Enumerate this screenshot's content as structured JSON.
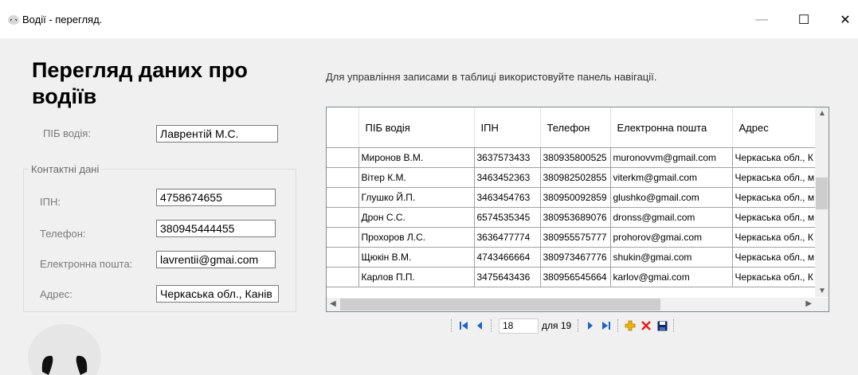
{
  "window": {
    "title": "Водії - перегляд.",
    "minimize": "—",
    "maximize": "☐",
    "close": "✕"
  },
  "heading": "Перегляд даних про водіїв",
  "form": {
    "name_label": "ПІБ водія:",
    "name_value": "Лаврентій М.С.",
    "contacts_group_title": "Контактні дані",
    "ipn_label": "ІПН:",
    "ipn_value": "4758674655",
    "phone_label": "Телефон:",
    "phone_value": "380945444455",
    "email_label": "Електронна пошта:",
    "email_value": "lavrentii@gmai.com",
    "address_label": "Адрес:",
    "address_value": "Черкаська обл., Канів"
  },
  "hint": "Для управління записами в таблиці використовуйте панель навігації.",
  "table": {
    "columns": [
      "ПІБ водія",
      "ІПН",
      "Телефон",
      "Електронна пошта",
      "Адрес"
    ],
    "rows": [
      [
        "Миронов В.М.",
        "3637573433",
        "380935800525",
        "muronovvm@gmail.com",
        "Черкаська обл., К"
      ],
      [
        "Вітер К.М.",
        "3463452363",
        "380982502855",
        "viterkm@gmail.com",
        "Черкаська обл., м"
      ],
      [
        "Глушко Й.П.",
        "3463454763",
        "380950092859",
        "glushko@gmail.com",
        "Черкаська обл., м"
      ],
      [
        "Дрон С.С.",
        "6574535345",
        "380953689076",
        "dronss@gmail.com",
        "Черкаська обл., м"
      ],
      [
        "Прохоров Л.С.",
        "3636477774",
        "380955575777",
        "prohorov@gmai.com",
        "Черкаська обл., К"
      ],
      [
        "Щюкін В.М.",
        "4743466664",
        "380973467776",
        "shukin@gmai.com",
        "Черкаська обл., м"
      ],
      [
        "Карлов П.П.",
        "3475643436",
        "380956545664",
        "karlov@gmai.com",
        "Черкаська обл., К"
      ]
    ]
  },
  "navigator": {
    "position": "18",
    "count": "для 19"
  },
  "icons": {
    "first": "move-first-icon",
    "prev": "move-previous-icon",
    "next": "move-next-icon",
    "last": "move-last-icon",
    "add": "add-icon",
    "delete": "delete-icon",
    "save": "save-icon"
  },
  "colors": {
    "nav_blue": "#1e63c8",
    "add_yellow": "#f0b400",
    "delete_red": "#e02020",
    "save_navy": "#0a2a6a"
  }
}
